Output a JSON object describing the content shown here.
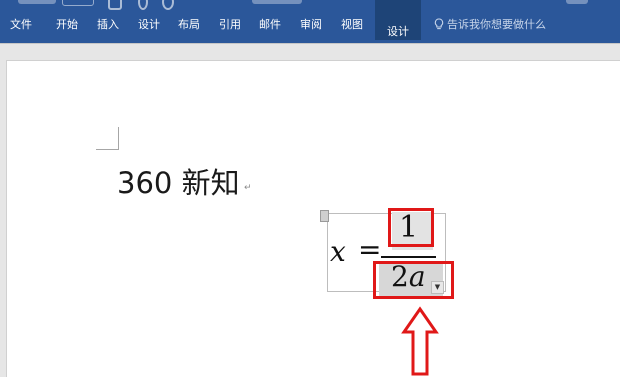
{
  "ribbon": {
    "tabs": [
      {
        "label": "文件"
      },
      {
        "label": "开始"
      },
      {
        "label": "插入"
      },
      {
        "label": "设计"
      },
      {
        "label": "布局"
      },
      {
        "label": "引用"
      },
      {
        "label": "邮件"
      },
      {
        "label": "审阅"
      },
      {
        "label": "视图"
      },
      {
        "label": "设计",
        "active": true
      }
    ],
    "tell_me": "告诉我你想要做什么",
    "tell_me_icon": "lightbulb-icon",
    "colors": {
      "ribbon": "#2b579a",
      "active_tab": "#1e4477"
    }
  },
  "document": {
    "body_text": "360 新知",
    "equation": {
      "variable": "x",
      "operator": "=",
      "numerator": "1",
      "denominator_coefficient": "2",
      "denominator_variable": "a"
    }
  },
  "annotations": {
    "highlight_color": "#e01818",
    "arrow": "up-arrow-icon"
  }
}
